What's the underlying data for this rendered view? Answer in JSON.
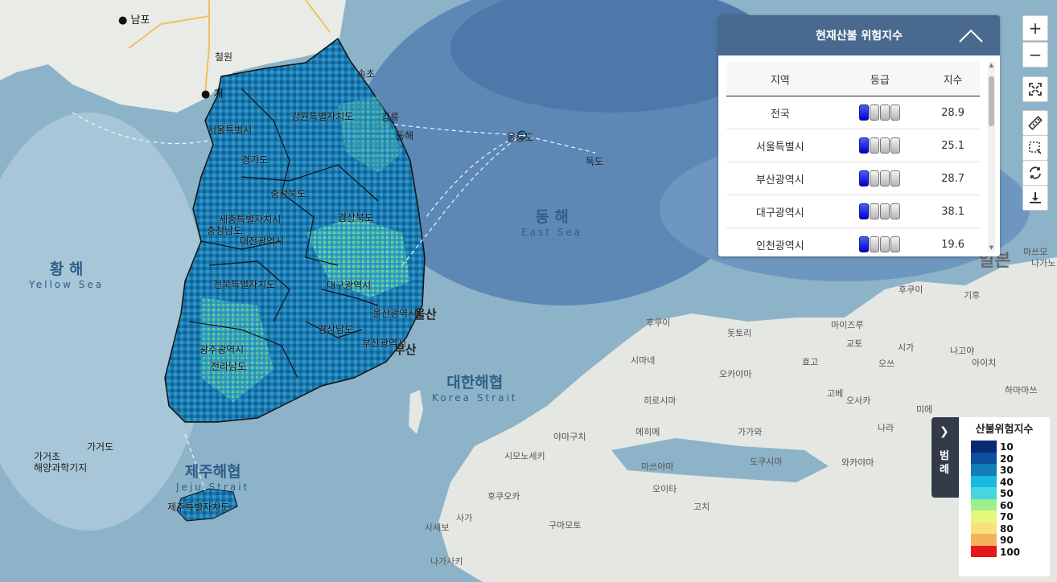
{
  "panel": {
    "title": "현재산불 위험지수",
    "columns": [
      "지역",
      "등급",
      "지수"
    ],
    "rows": [
      {
        "region": "전국",
        "grade_level": 1,
        "index": "28.9"
      },
      {
        "region": "서울특별시",
        "grade_level": 1,
        "index": "25.1"
      },
      {
        "region": "부산광역시",
        "grade_level": 1,
        "index": "28.7"
      },
      {
        "region": "대구광역시",
        "grade_level": 1,
        "index": "38.1"
      },
      {
        "region": "인천광역시",
        "grade_level": 1,
        "index": "19.6"
      }
    ]
  },
  "tools": {
    "zoom_in": "+",
    "zoom_out": "−",
    "icons": [
      "fullscreen-icon",
      "ruler-icon",
      "area-select-icon",
      "refresh-icon",
      "download-icon"
    ]
  },
  "legend": {
    "tab_label": "범례",
    "title": "산불위험지수",
    "steps": [
      "10",
      "20",
      "30",
      "40",
      "50",
      "60",
      "70",
      "80",
      "90",
      "100"
    ],
    "colors": [
      "#0a2a70",
      "#0b4f9e",
      "#0f7fb6",
      "#19b8e0",
      "#45d6e0",
      "#9cf08a",
      "#e6f77a",
      "#f8e27d",
      "#f5b25c",
      "#e51919"
    ]
  },
  "seas": {
    "east_ko": "동 해",
    "east_en": "East Sea",
    "yellow_ko": "황 해",
    "yellow_en": "Yellow Sea",
    "korea_strait_ko": "대한해협",
    "korea_strait_en": "Korea Strait",
    "jeju_strait_ko": "제주해협",
    "jeju_strait_en": "Jeju Strait"
  },
  "places": {
    "nampo": "남포",
    "cheorwon": "철원",
    "gaeseong": "개",
    "sokcho": "속초",
    "gangneung": "강릉",
    "donghae": "동해",
    "ulleungdo": "울릉도",
    "dokdo": "독도",
    "gageocho": "가거도",
    "gageocho_base": "가거초\n해양과학기지",
    "busan_city": "부산",
    "ulsan_city": "울산"
  },
  "provinces": {
    "seoul": "서울특별시",
    "gyeonggi": "경기도",
    "gangwon": "강원특별자치도",
    "chungbuk": "충청북도",
    "sejong": "세종특별자치시",
    "chungnam": "충청남도",
    "daejeon": "대전광역시",
    "gyeongbuk": "경상북도",
    "jeonbuk": "전북특별자치도",
    "daegu": "대구광역시",
    "ulsan": "울산광역시",
    "gyeongnam": "경상남도",
    "busan": "부산광역시",
    "gwangju": "광주광역시",
    "jeonnam": "전라남도",
    "jeju": "제주특별자치도"
  },
  "japan": {
    "japan": "일본",
    "hukui": "후쿠이",
    "giho": "기후",
    "matsumoto": "마쓰모",
    "nagano": "나가노",
    "tottori": "돗토리",
    "maizuru": "마이즈루",
    "gyoto": "교토",
    "otsu": "오쓰",
    "siga": "시가",
    "nagoya": "나고야",
    "aichi": "아이치",
    "hyogo": "효고",
    "hamamatsu": "하마마쓰",
    "okayama": "오카야마",
    "kobe": "고베",
    "osaka": "오사카",
    "mie": "미에",
    "nara": "나라",
    "shimane": "시마네",
    "hiroshima": "히로시마",
    "gagawa": "가가와",
    "tokushima": "도쿠시마",
    "wakayama": "와카야마",
    "yamaguchi": "야마구치",
    "shimonoseki": "시모노세키",
    "ehime": "에히메",
    "matsuyama": "마쓰야마",
    "fukuoka": "후쿠오카",
    "saga": "사가",
    "oita": "오이타",
    "kochi": "고치",
    "sasebo": "사세보",
    "nagasaki": "나가사키",
    "kumamoto": "구마모토",
    "hukui2": "후쿠이"
  }
}
